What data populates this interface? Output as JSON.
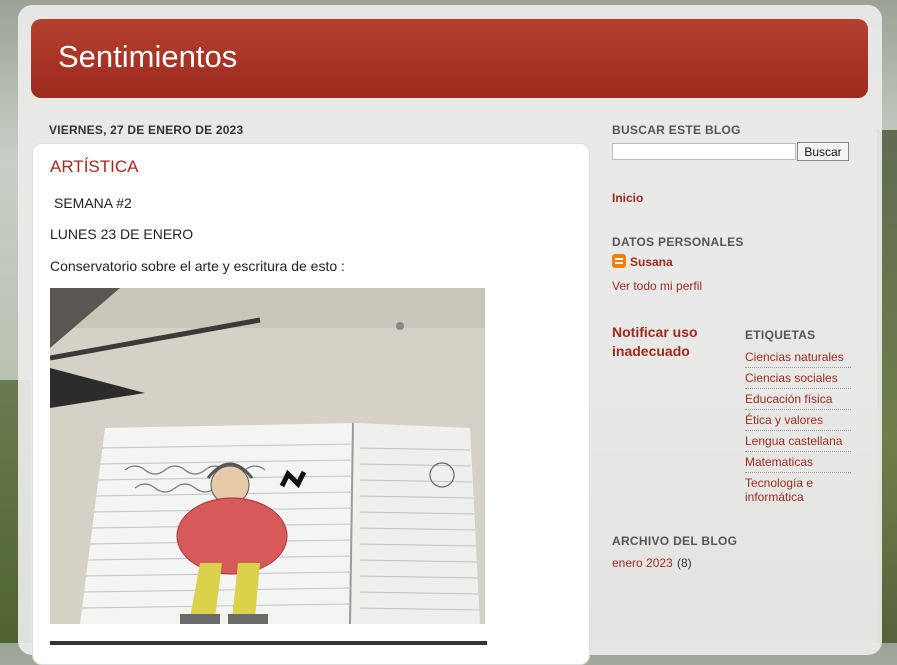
{
  "blog": {
    "title": "Sentimientos"
  },
  "post": {
    "date": "VIERNES, 27 DE ENERO DE 2023",
    "title": "ARTÍSTICA",
    "lines": [
      "SEMANA #2",
      "LUNES 23 DE ENERO",
      "Conservatorio sobre el arte y escritura de esto :"
    ]
  },
  "sidebar": {
    "search": {
      "heading": "BUSCAR ESTE BLOG",
      "button": "Buscar",
      "value": ""
    },
    "home_link": "Inicio",
    "profile": {
      "heading": "DATOS PERSONALES",
      "name": "Susana",
      "view_profile": "Ver todo mi perfil"
    },
    "report": "Notificar uso inadecuado",
    "labels": {
      "heading": "ETIQUETAS",
      "items": [
        "Ciencias naturales",
        "Ciencias sociales",
        "Educación física",
        "Ética y valores",
        "Lengua castellana",
        "Matematicas",
        "Tecnología e informática"
      ]
    },
    "archive": {
      "heading": "ARCHIVO DEL BLOG",
      "month": "enero 2023",
      "count": "(8)"
    }
  },
  "colors": {
    "header": "#9d2a1d",
    "link": "#9d2a1d"
  },
  "icons": {
    "profile": "blogger-icon"
  }
}
